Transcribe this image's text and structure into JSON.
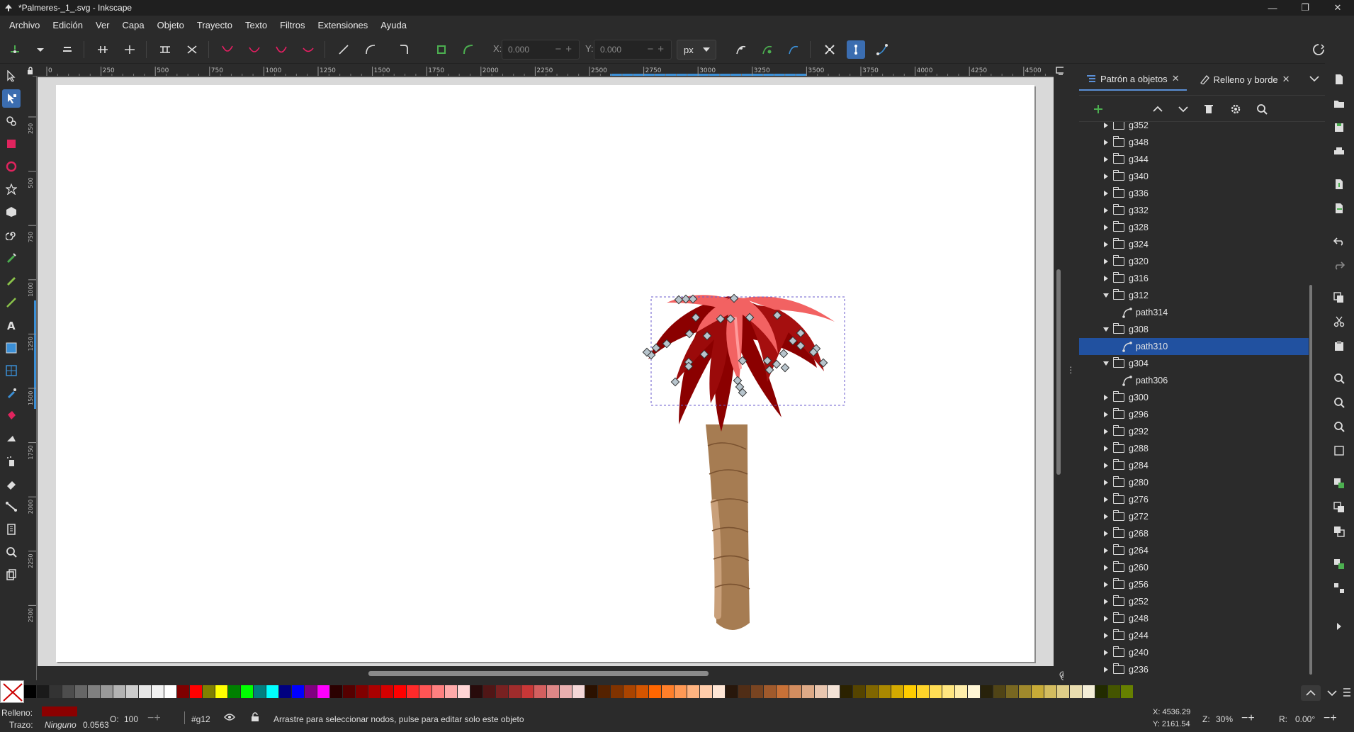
{
  "window": {
    "title": "*Palmeres-_1_.svg - Inkscape",
    "controls": [
      "—",
      "❐",
      "✕"
    ]
  },
  "menu": [
    "Archivo",
    "Edición",
    "Ver",
    "Capa",
    "Objeto",
    "Trayecto",
    "Texto",
    "Filtros",
    "Extensiones",
    "Ayuda"
  ],
  "controls_bar": {
    "x_label": "X:",
    "x_value": "0.000",
    "y_label": "Y:",
    "y_value": "0.000",
    "unit": "px"
  },
  "ruler": {
    "top_labels": [
      "0",
      "250",
      "500",
      "750",
      "1000",
      "1250",
      "1500",
      "1750",
      "2000",
      "2250",
      "2500",
      "2750",
      "3000",
      "3250",
      "3500",
      "3750",
      "4000",
      "4250",
      "4500"
    ],
    "left_labels": [
      "250",
      "500",
      "750",
      "1000",
      "1250",
      "1500",
      "1750",
      "2000",
      "2250",
      "2500"
    ]
  },
  "panel": {
    "tabs": [
      {
        "label": "Patrón a objetos",
        "active": true
      },
      {
        "label": "Relleno y borde",
        "active": false
      }
    ],
    "tree": [
      {
        "label": "g352",
        "kind": "group",
        "expanded": false,
        "depth": 0
      },
      {
        "label": "g348",
        "kind": "group",
        "expanded": false,
        "depth": 0
      },
      {
        "label": "g344",
        "kind": "group",
        "expanded": false,
        "depth": 0
      },
      {
        "label": "g340",
        "kind": "group",
        "expanded": false,
        "depth": 0
      },
      {
        "label": "g336",
        "kind": "group",
        "expanded": false,
        "depth": 0
      },
      {
        "label": "g332",
        "kind": "group",
        "expanded": false,
        "depth": 0
      },
      {
        "label": "g328",
        "kind": "group",
        "expanded": false,
        "depth": 0
      },
      {
        "label": "g324",
        "kind": "group",
        "expanded": false,
        "depth": 0
      },
      {
        "label": "g320",
        "kind": "group",
        "expanded": false,
        "depth": 0
      },
      {
        "label": "g316",
        "kind": "group",
        "expanded": false,
        "depth": 0
      },
      {
        "label": "g312",
        "kind": "group",
        "expanded": true,
        "depth": 0
      },
      {
        "label": "path314",
        "kind": "path",
        "depth": 1
      },
      {
        "label": "g308",
        "kind": "group",
        "expanded": true,
        "depth": 0
      },
      {
        "label": "path310",
        "kind": "path",
        "depth": 1,
        "selected": true
      },
      {
        "label": "g304",
        "kind": "group",
        "expanded": true,
        "depth": 0
      },
      {
        "label": "path306",
        "kind": "path",
        "depth": 1
      },
      {
        "label": "g300",
        "kind": "group",
        "expanded": false,
        "depth": 0
      },
      {
        "label": "g296",
        "kind": "group",
        "expanded": false,
        "depth": 0
      },
      {
        "label": "g292",
        "kind": "group",
        "expanded": false,
        "depth": 0
      },
      {
        "label": "g288",
        "kind": "group",
        "expanded": false,
        "depth": 0
      },
      {
        "label": "g284",
        "kind": "group",
        "expanded": false,
        "depth": 0
      },
      {
        "label": "g280",
        "kind": "group",
        "expanded": false,
        "depth": 0
      },
      {
        "label": "g276",
        "kind": "group",
        "expanded": false,
        "depth": 0
      },
      {
        "label": "g272",
        "kind": "group",
        "expanded": false,
        "depth": 0
      },
      {
        "label": "g268",
        "kind": "group",
        "expanded": false,
        "depth": 0
      },
      {
        "label": "g264",
        "kind": "group",
        "expanded": false,
        "depth": 0
      },
      {
        "label": "g260",
        "kind": "group",
        "expanded": false,
        "depth": 0
      },
      {
        "label": "g256",
        "kind": "group",
        "expanded": false,
        "depth": 0
      },
      {
        "label": "g252",
        "kind": "group",
        "expanded": false,
        "depth": 0
      },
      {
        "label": "g248",
        "kind": "group",
        "expanded": false,
        "depth": 0
      },
      {
        "label": "g244",
        "kind": "group",
        "expanded": false,
        "depth": 0
      },
      {
        "label": "g240",
        "kind": "group",
        "expanded": false,
        "depth": 0
      },
      {
        "label": "g236",
        "kind": "group",
        "expanded": false,
        "depth": 0
      }
    ]
  },
  "palette": {
    "colors": [
      "#000000",
      "#1a1a1a",
      "#333333",
      "#4d4d4d",
      "#666666",
      "#808080",
      "#999999",
      "#b3b3b3",
      "#cccccc",
      "#e6e6e6",
      "#f2f2f2",
      "#ffffff",
      "#800000",
      "#ff0000",
      "#808000",
      "#ffff00",
      "#008000",
      "#00ff00",
      "#008080",
      "#00ffff",
      "#000080",
      "#0000ff",
      "#800080",
      "#ff00ff",
      "#2b0000",
      "#550000",
      "#800000",
      "#aa0000",
      "#d40000",
      "#ff0000",
      "#ff2a2a",
      "#ff5555",
      "#ff8080",
      "#ffaaaa",
      "#ffd5d5",
      "#280b0b",
      "#501616",
      "#782121",
      "#a02c2c",
      "#c83737",
      "#d35f5f",
      "#de8787",
      "#e9afaf",
      "#f4d7d7",
      "#2b1100",
      "#552200",
      "#803300",
      "#aa4400",
      "#d45500",
      "#ff6600",
      "#ff7f2a",
      "#ff9955",
      "#ffb380",
      "#ffccaa",
      "#ffe6d5",
      "#28170b",
      "#502d16",
      "#784421",
      "#a05a2c",
      "#c87137",
      "#d38d5f",
      "#deaa87",
      "#e9c6af",
      "#f4e3d7",
      "#2b2200",
      "#554400",
      "#806600",
      "#aa8800",
      "#d4aa00",
      "#ffcc00",
      "#ffd42a",
      "#ffdd55",
      "#ffe680",
      "#ffeeaa",
      "#fff6d5",
      "#28220b",
      "#504416",
      "#786721",
      "#a0892c",
      "#c8ab37",
      "#d3bc5f",
      "#decd87",
      "#e9ddaf",
      "#f4eed7",
      "#222b00",
      "#445500",
      "#668000"
    ]
  },
  "status": {
    "fill_label": "Relleno:",
    "stroke_label": "Trazo:",
    "stroke_value": "Ninguno",
    "stroke_width": "0.0563",
    "opacity_label": "O:",
    "opacity_value": "100",
    "layer": "#g12",
    "message": "Arrastre para seleccionar nodos, pulse para editar solo este objeto",
    "x_coord": "X: 4536.29",
    "y_coord": "Y: 2161.54",
    "zoom_label": "Z:",
    "zoom": "30%",
    "rotation_label": "R:",
    "rotation": "0.00°"
  },
  "colors": {
    "accent": "#3b6db0",
    "selected_row": "#2151a0",
    "fill_color": "#8b0000"
  }
}
